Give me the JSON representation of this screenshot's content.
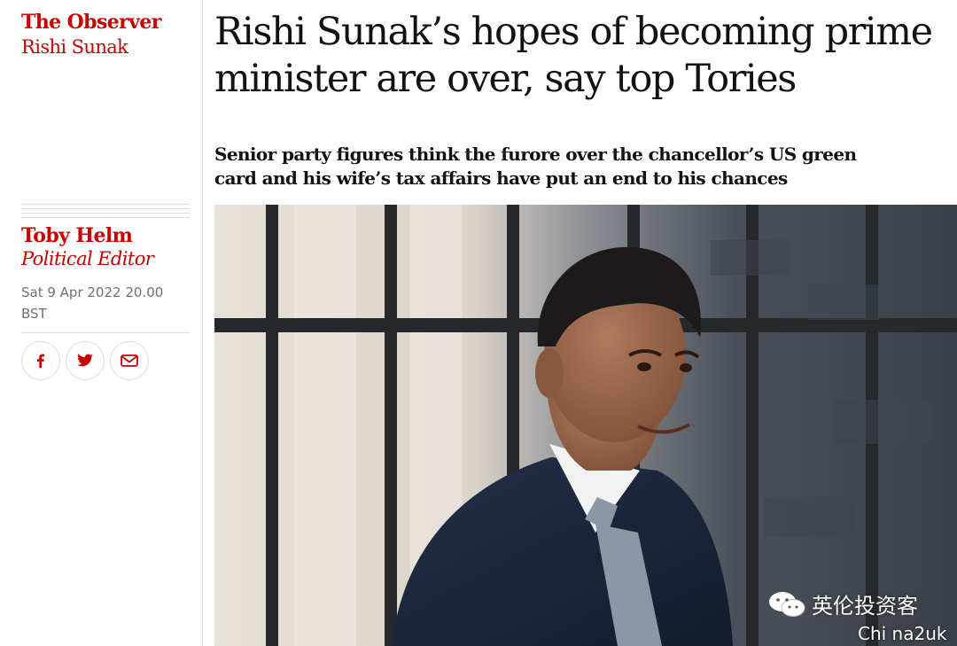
{
  "left": {
    "series": "The Observer",
    "tag": "Rishi Sunak",
    "byline_name": "Toby Helm",
    "byline_role": "Political Editor",
    "date": "Sat 9 Apr 2022 20.00",
    "timezone": "BST"
  },
  "share": [
    "facebook-icon",
    "twitter-icon",
    "email-icon"
  ],
  "article": {
    "headline": "Rishi Sunak’s hopes of becoming prime minister are over, say top Tories",
    "standfirst": "Senior party figures think the furore over the chancellor’s US green card and his wife’s tax affairs have put an end to his chances"
  },
  "overlay": {
    "watermark": "英伦投资客",
    "source": "Chi na2uk"
  },
  "colors": {
    "accent": "#c70000",
    "text": "#121212",
    "muted": "#707070",
    "rule": "#dcdcdc"
  }
}
